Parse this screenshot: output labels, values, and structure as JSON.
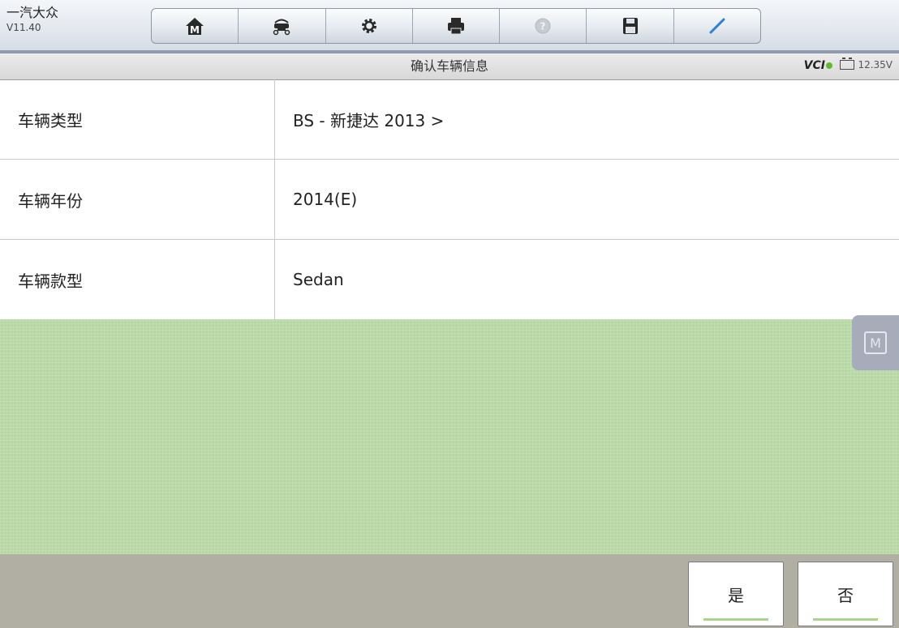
{
  "app": {
    "brand_name": "一汽大众",
    "version": "V11.40"
  },
  "toolbar": {
    "buttons": [
      {
        "icon": "home-icon"
      },
      {
        "icon": "vehicle-lift-icon"
      },
      {
        "icon": "gear-icon"
      },
      {
        "icon": "printer-icon"
      },
      {
        "icon": "help-icon"
      },
      {
        "icon": "save-icon"
      },
      {
        "icon": "pen-icon"
      }
    ]
  },
  "titlebar": {
    "title": "确认车辆信息",
    "vci_label": "VCI",
    "battery_voltage": "12.35V"
  },
  "vehicle_info": [
    {
      "label": "车辆类型",
      "value": "BS - 新捷达 2013 >"
    },
    {
      "label": "车辆年份",
      "value": "2014(E)"
    },
    {
      "label": "车辆款型",
      "value": "Sedan"
    }
  ],
  "side_button": {
    "icon_letter": "M"
  },
  "actions": {
    "yes_label": "是",
    "no_label": "否"
  },
  "colors": {
    "accent_green": "#b7d8a4",
    "bottom_bar": "#b1aea4",
    "vci_status": "#5dbb2e"
  }
}
